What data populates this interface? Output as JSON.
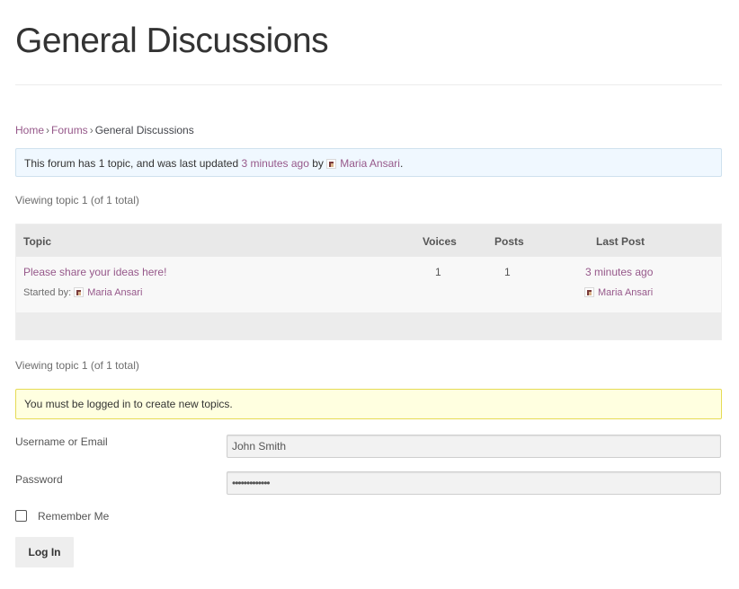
{
  "page": {
    "title": "General Discussions"
  },
  "breadcrumb": {
    "home": "Home",
    "forums": "Forums",
    "current": "General Discussions",
    "separator": "›"
  },
  "forum_info": {
    "text_before": "This forum has 1 topic, and was last updated",
    "updated_link": "3 minutes ago",
    "by_text": "by",
    "author": "Maria Ansari",
    "end": "."
  },
  "pagination": {
    "top": "Viewing topic 1 (of 1 total)",
    "bottom": "Viewing topic 1 (of 1 total)"
  },
  "table": {
    "headers": {
      "topic": "Topic",
      "voices": "Voices",
      "posts": "Posts",
      "last_post": "Last Post"
    },
    "rows": [
      {
        "title": "Please share your ideas here!",
        "started_by_label": "Started by:",
        "started_by": "Maria Ansari",
        "voices": "1",
        "posts": "1",
        "last_post_time": "3 minutes ago",
        "last_post_author": "Maria Ansari"
      }
    ]
  },
  "login_notice": "You must be logged in to create new topics.",
  "login_form": {
    "username_label": "Username or Email",
    "username_value": "John Smith",
    "password_label": "Password",
    "password_value": "•••••••••••••",
    "remember_label": "Remember Me",
    "submit_label": "Log In"
  },
  "colors": {
    "link": "#96588a",
    "info_bg": "#f0f8ff",
    "warn_bg": "#ffffe0",
    "warn_border": "#e6db55"
  }
}
